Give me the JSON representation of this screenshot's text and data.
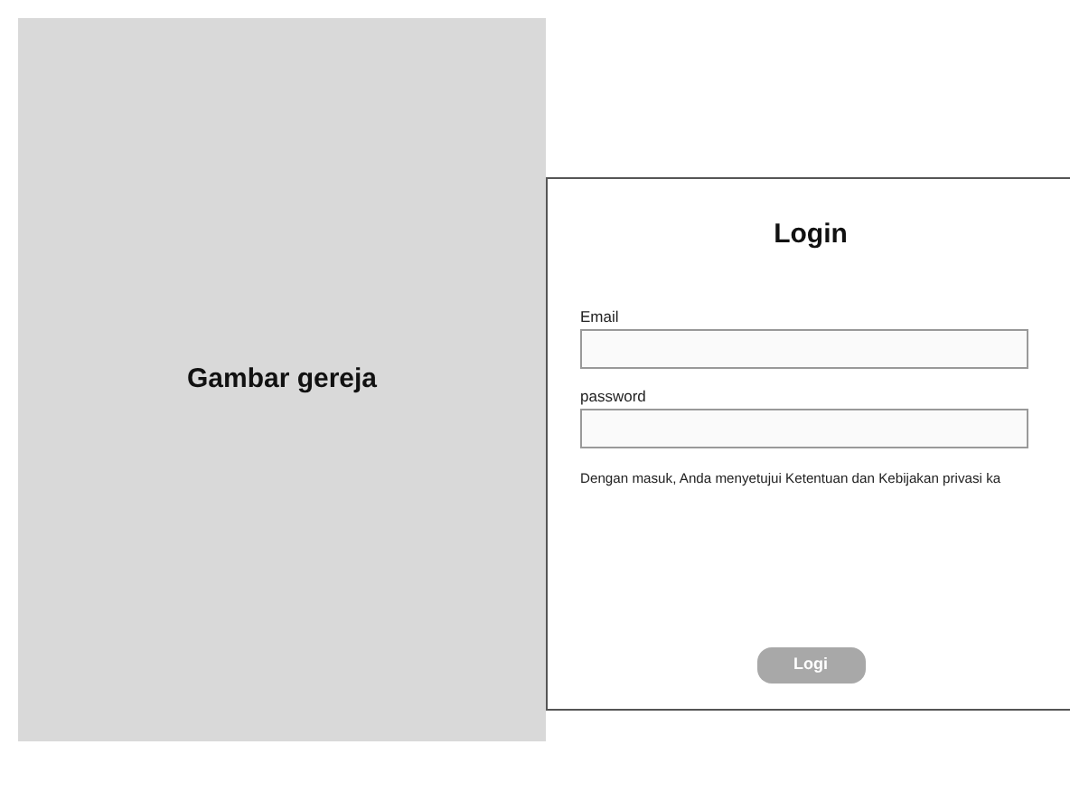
{
  "image_panel": {
    "label": "Gambar gereja"
  },
  "login_card": {
    "title": "Login",
    "fields": [
      {
        "label": "Email"
      },
      {
        "label": "password"
      }
    ],
    "terms": "Dengan masuk, Anda menyetujui Ketentuan dan Kebijakan privasi ka",
    "button": "Logi"
  }
}
